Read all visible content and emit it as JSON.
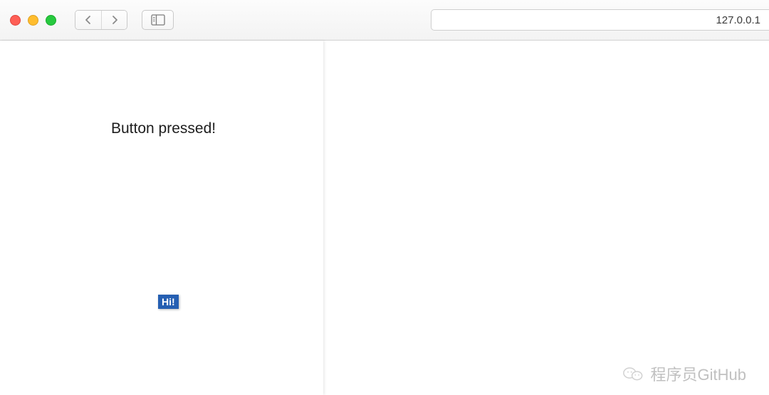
{
  "browser": {
    "address": "127.0.0.1"
  },
  "page": {
    "status_text": "Button pressed!",
    "hi_button_label": "Hi!"
  },
  "watermark": {
    "text": "程序员GitHub"
  }
}
